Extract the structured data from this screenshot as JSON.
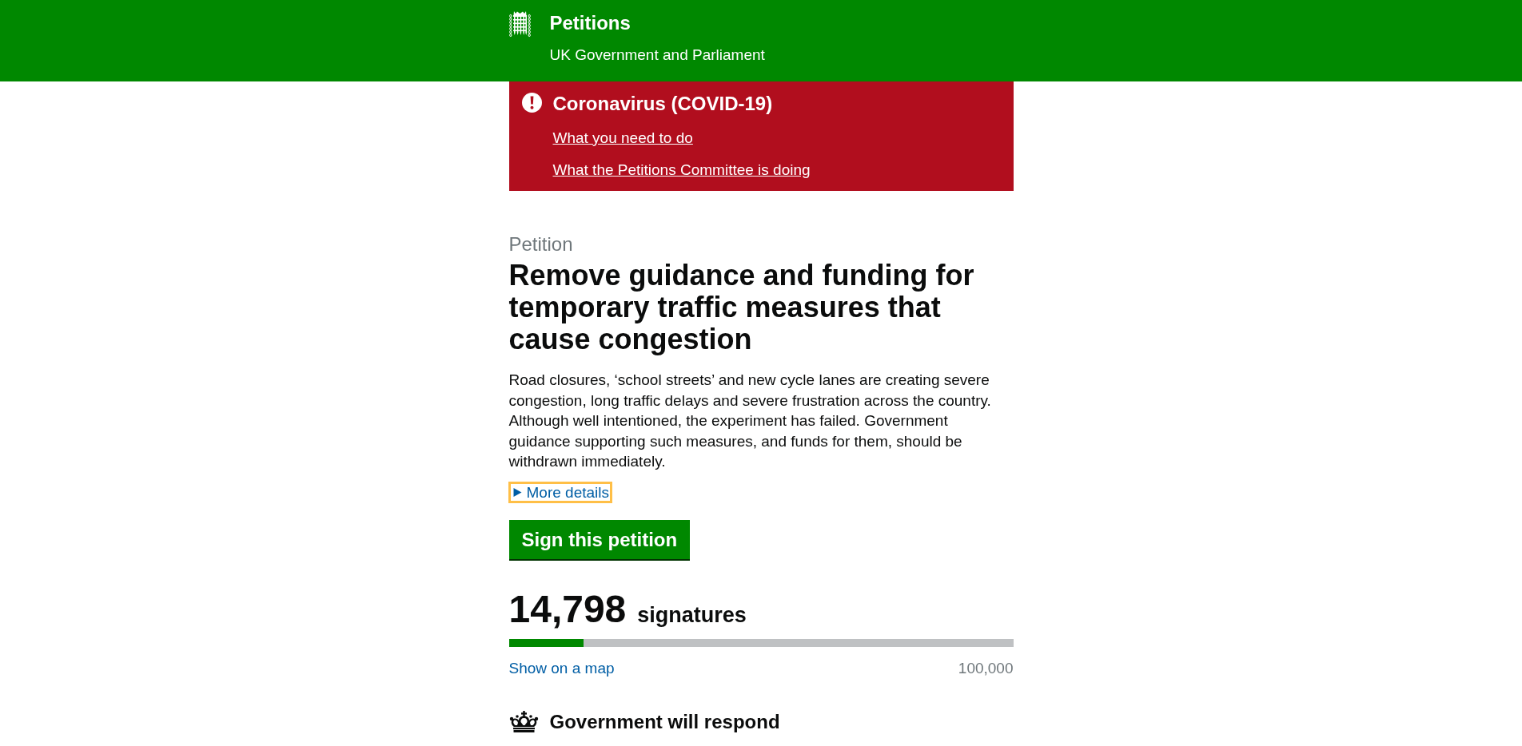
{
  "header": {
    "title": "Petitions",
    "subtitle": "UK Government and Parliament"
  },
  "alert": {
    "title": "Coronavirus (COVID-19)",
    "links": [
      "What you need to do",
      "What the Petitions Committee is doing"
    ]
  },
  "petition": {
    "label": "Petition",
    "title": "Remove guidance and funding for temporary traffic measures that cause congestion",
    "description": "Road closures, ‘school streets’ and new cycle lanes are creating severe congestion, long traffic delays and severe frustration across the country. Although well intentioned, the experiment has failed. Government guidance supporting such measures, and funds for them, should be withdrawn immediately.",
    "more_details": {
      "label": "More details",
      "expanded": false,
      "focused": true
    },
    "sign_button": "Sign this petition",
    "signatures": {
      "count": "14,798",
      "label": "signatures",
      "level": 0.148,
      "map_link": "Show on a map",
      "target": "100,000"
    },
    "response": {
      "label": "Government will respond"
    }
  }
}
